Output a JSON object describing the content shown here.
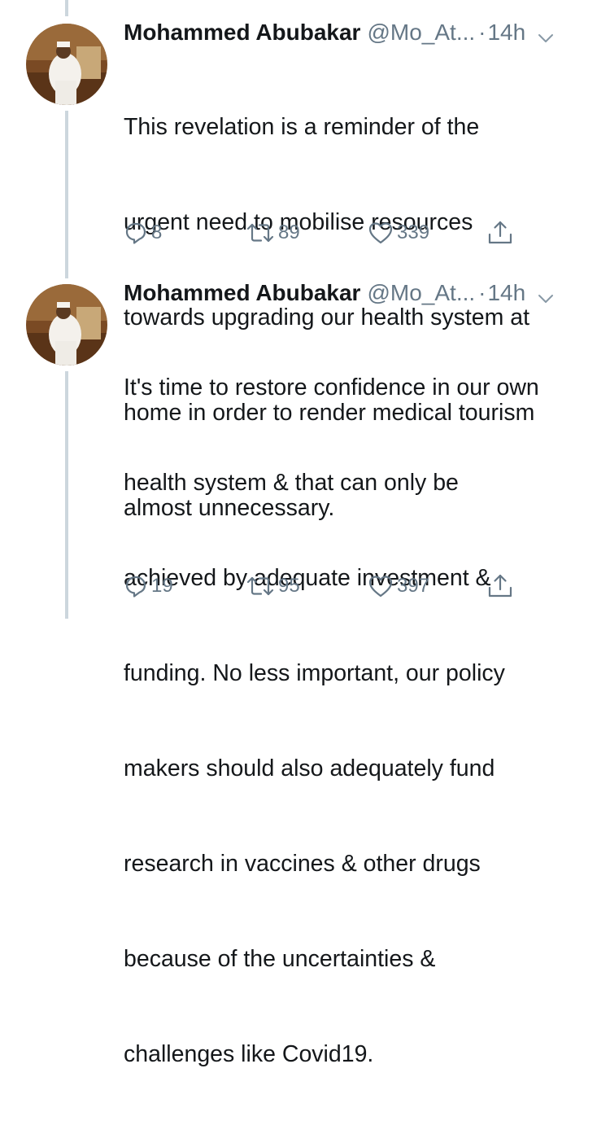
{
  "tweets": [
    {
      "author_name": "Mohammed Abubakar",
      "handle": "@Mo_At...",
      "separator": "·",
      "time": "14h",
      "text_lines": [
        "This revelation is a reminder of the",
        "urgent need to mobilise resources",
        "towards upgrading our health system at",
        "home in order to render medical tourism",
        "almost unnecessary."
      ],
      "replies": "8",
      "retweets": "89",
      "likes": "339"
    },
    {
      "author_name": "Mohammed Abubakar",
      "handle": "@Mo_At...",
      "separator": "·",
      "time": "14h",
      "text_lines": [
        "It's time to restore confidence in our own",
        "health system & that can only be",
        "achieved by adequate investment &",
        "funding. No less important, our policy",
        "makers should also adequately fund",
        "research in vaccines & other drugs",
        "because of the uncertainties &",
        "challenges like  Covid19."
      ],
      "replies": "19",
      "retweets": "95",
      "likes": "397"
    }
  ],
  "icons": {
    "reply": "reply-icon",
    "retweet": "retweet-icon",
    "like": "heart-icon",
    "share": "share-icon",
    "menu": "chevron-down-icon"
  },
  "colors": {
    "text": "#14171a",
    "secondary": "#657786",
    "thread_line": "#ccd6dd"
  }
}
